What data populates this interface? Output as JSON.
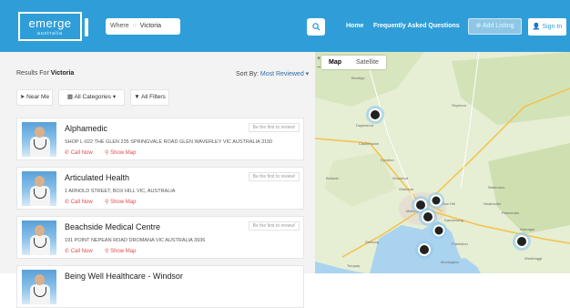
{
  "header": {
    "logo_word": "emerge",
    "logo_sub": "australia",
    "where_label": "Where",
    "where_value": "Victoria",
    "nav": {
      "home": "Home",
      "faq": "Frequently Asked Questions"
    },
    "add_listing": "Add Listing",
    "sign_in": "Sign In"
  },
  "results": {
    "prefix": "Results For",
    "location": "Victoria"
  },
  "sort": {
    "label": "Sort By:",
    "value": "Most Reviewed"
  },
  "filters": {
    "near_me": "Near Me",
    "all_categories": "All Categories",
    "all_filters": "All Filters"
  },
  "listings": [
    {
      "name": "Alphamedic",
      "address": "SHOP L-022 THE GLEN 235 SPRINGVALE ROAD GLEN WAVERLEY VIC AUSTRALIA 3150",
      "call": "Call Now",
      "map": "Show Map",
      "review": "Be the first to review!"
    },
    {
      "name": "Articulated Health",
      "address": "1 ARNOLD STREET, BOX HILL VIC, AUSTRALIA",
      "call": "Call Now",
      "map": "Show Map",
      "review": "Be the first to review!"
    },
    {
      "name": "Beachside Medical Centre",
      "address": "191 POINT NEPEAN ROAD DROMANA VIC AUSTRALIA 3936",
      "call": "Call Now",
      "map": "Show Map",
      "review": "Be the first to review!"
    },
    {
      "name": "Being Well Healthcare - Windsor",
      "address": "",
      "call": "",
      "map": "",
      "review": ""
    }
  ],
  "map": {
    "map_label": "Map",
    "satellite_label": "Satellite",
    "zoom_in": "+",
    "zoom_out": "−",
    "place_labels": [
      "Castlemaine",
      "Kyneton",
      "Woodend",
      "Gisborne",
      "Melbourne",
      "Box Hill",
      "Dandenong",
      "Frankston",
      "Mornington",
      "Warburton",
      "Warragul",
      "Wonthaggi",
      "Geelong",
      "Torquay",
      "Ballarat",
      "Daylesford",
      "Bendigo",
      "Seymour",
      "Healesville",
      "Pakenham"
    ]
  },
  "colors": {
    "brand": "#2f9ed8",
    "accent_red": "#e24b4b",
    "map_land": "#e8f0d8",
    "map_water": "#aad3f0"
  }
}
